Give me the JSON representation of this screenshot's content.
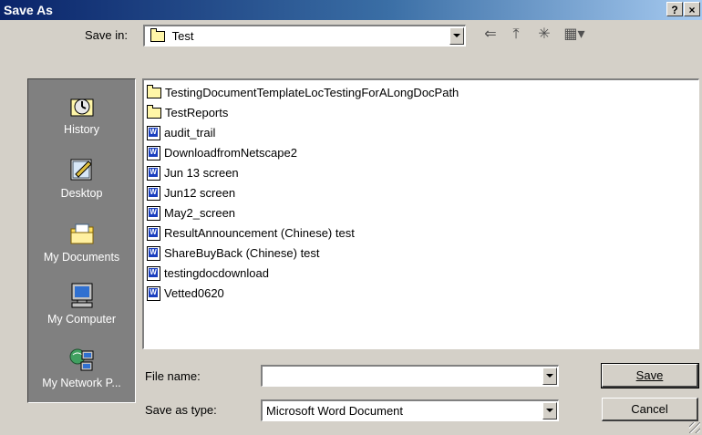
{
  "window": {
    "title": "Save As",
    "help_glyph": "?",
    "close_glyph": "×"
  },
  "save_in": {
    "label": "Save in:",
    "folder": "Test",
    "toolbar": {
      "back_glyph": "⇐",
      "up_glyph": "⤒",
      "new_folder_glyph": "✳",
      "views_glyph": "▦▾"
    }
  },
  "places": [
    {
      "label": "History",
      "icon": "history-icon"
    },
    {
      "label": "Desktop",
      "icon": "desktop-icon"
    },
    {
      "label": "My Documents",
      "icon": "my-documents-icon"
    },
    {
      "label": "My Computer",
      "icon": "my-computer-icon"
    },
    {
      "label": "My Network P...",
      "icon": "my-network-places-icon"
    }
  ],
  "files": [
    {
      "name": "TestingDocumentTemplateLocTestingForALongDocPath",
      "type": "folder"
    },
    {
      "name": "TestReports",
      "type": "folder"
    },
    {
      "name": "audit_trail",
      "type": "word-doc"
    },
    {
      "name": "DownloadfromNetscape2",
      "type": "word-doc"
    },
    {
      "name": "Jun 13 screen",
      "type": "word-doc"
    },
    {
      "name": "Jun12 screen",
      "type": "word-doc"
    },
    {
      "name": "May2_screen",
      "type": "word-doc"
    },
    {
      "name": "ResultAnnouncement (Chinese) test",
      "type": "word-doc"
    },
    {
      "name": "ShareBuyBack (Chinese) test",
      "type": "word-doc"
    },
    {
      "name": "testingdocdownload",
      "type": "word-doc"
    },
    {
      "name": "Vetted0620",
      "type": "word-doc"
    }
  ],
  "file_name": {
    "label": "File name:",
    "value": ""
  },
  "save_as_type": {
    "label": "Save as type:",
    "value": "Microsoft Word Document"
  },
  "buttons": {
    "save": "Save",
    "cancel": "Cancel"
  },
  "colors": {
    "title_bar": "#0a246a",
    "dialog_face": "#d4d0c8",
    "places_bar": "#808080",
    "folder": "#fff6a8",
    "word_icon": "#1a3fbf"
  }
}
